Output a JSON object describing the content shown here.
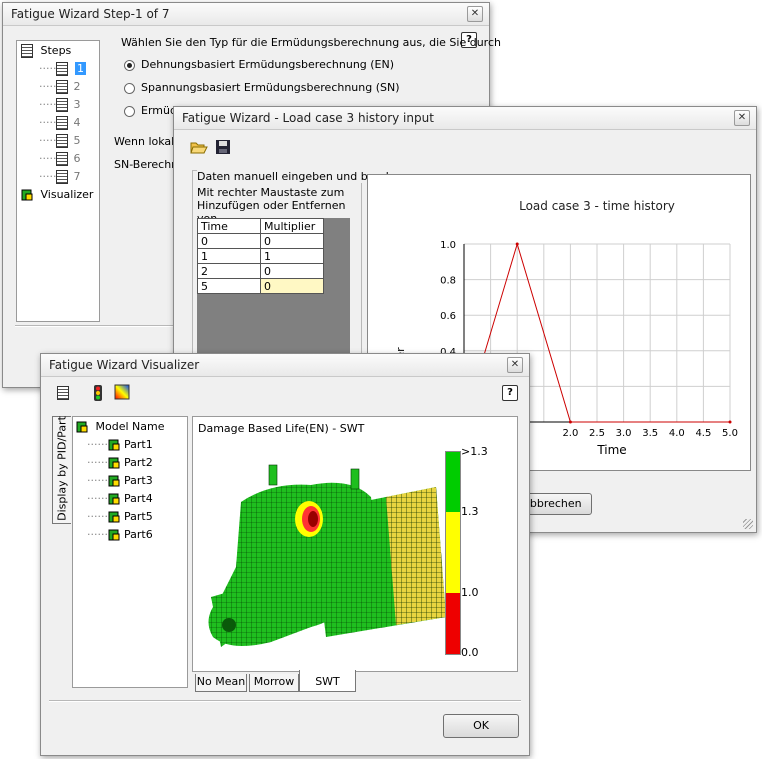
{
  "step_window": {
    "title": "Fatigue Wizard Step-1 of 7",
    "close": "✕",
    "help": "?",
    "tree": {
      "root": "Steps",
      "steps": [
        "1",
        "2",
        "3",
        "4",
        "5",
        "6",
        "7"
      ],
      "visualizer": "Visualizer"
    },
    "prompt": "Wählen Sie den Typ für die Ermüdungsberechnung aus, die Sie durch",
    "options": [
      "Dehnungsbasiert Ermüdungsberechnung (EN)",
      "Spannungsbasiert Ermüdungsberechnung (SN)",
      "Ermüdungsberechnung"
    ],
    "line1": "Wenn lokale",
    "line2": "SN-Berechn"
  },
  "load_window": {
    "title": "Fatigue Wizard - Load case 3 history input",
    "close": "✕",
    "group_label": "Daten manuell eingeben und bearb",
    "hint": "Mit rechter Maustaste zum Hinzufügen oder Entfernen von",
    "columns": [
      "Time",
      "Multiplier"
    ],
    "rows": [
      [
        "0",
        "0"
      ],
      [
        "1",
        "1"
      ],
      [
        "2",
        "0"
      ],
      [
        "5",
        "0"
      ]
    ],
    "cancel": "Abbrechen"
  },
  "chart_data": {
    "type": "line",
    "title": "Load case  3 - time history",
    "xlabel": "Time",
    "ylabel": "Multiplier",
    "x": [
      0,
      1,
      2,
      5
    ],
    "series": [
      {
        "values": [
          0,
          1,
          0,
          0
        ],
        "color": "#cc0000"
      }
    ],
    "xlim": [
      0,
      5
    ],
    "ylim": [
      0,
      1
    ],
    "xticks": [
      "2.0",
      "2.5",
      "3.0",
      "3.5",
      "4.0",
      "4.5",
      "5.0"
    ],
    "yticks": [
      "1.0",
      "0.8",
      "0.6",
      "0.4"
    ],
    "grid": true
  },
  "vis_window": {
    "title": "Fatigue Wizard Visualizer",
    "close": "✕",
    "help": "?",
    "side_tab": "Display by PID/Part",
    "model_root": "Model Name",
    "parts": [
      "Part1",
      "Part2",
      "Part3",
      "Part4",
      "Part5",
      "Part6"
    ],
    "result_title": "Damage Based Life(EN) - SWT",
    "legend": [
      ">1.3",
      "1.3",
      "1.0",
      "0.0"
    ],
    "legend_colors": [
      "#00cc00",
      "#ffff00",
      "#ee0000"
    ],
    "tabs": [
      "No Mean",
      "Morrow",
      "SWT"
    ],
    "ok": "OK"
  }
}
